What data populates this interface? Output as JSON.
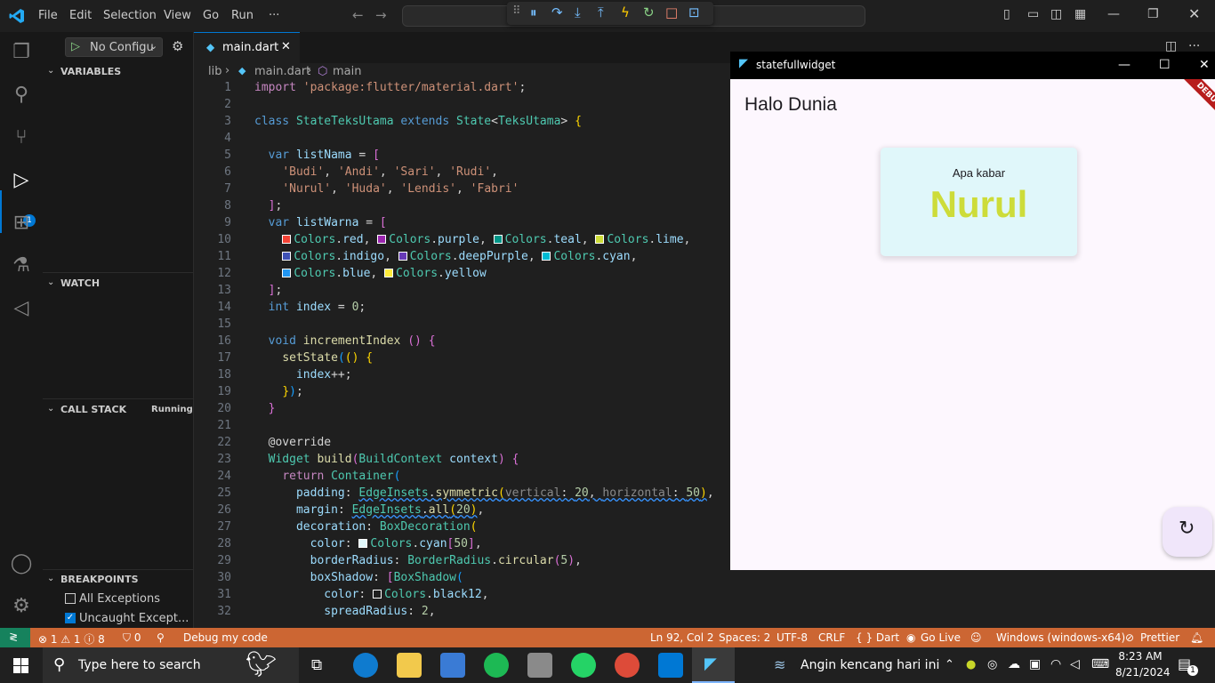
{
  "titlebar": {
    "menu": [
      "File",
      "Edit",
      "Selection",
      "View",
      "Go",
      "Run",
      "···"
    ]
  },
  "sidebar": {
    "run_config": "No Configu",
    "variables": "VARIABLES",
    "watch": "WATCH",
    "call_stack": "CALL STACK",
    "call_stack_status": "Running",
    "breakpoints": "BREAKPOINTS",
    "bp_all": "All Exceptions",
    "bp_uncaught": "Uncaught Except...",
    "debug_badge": "1"
  },
  "editor": {
    "tab": "main.dart",
    "breadcrumb": [
      "lib",
      "main.dart",
      "main"
    ],
    "line_numbers": [
      "1",
      "2",
      "3",
      "4",
      "5",
      "6",
      "7",
      "8",
      "9",
      "10",
      "11",
      "12",
      "13",
      "14",
      "15",
      "16",
      "17",
      "18",
      "19",
      "20",
      "21",
      "22",
      "23",
      "24",
      "25",
      "26",
      "27",
      "28",
      "29",
      "30",
      "31",
      "32"
    ]
  },
  "flutter_window": {
    "title": "statefullwidget",
    "heading": "Halo Dunia",
    "card_label": "Apa kabar",
    "card_name": "Nurul",
    "ribbon": "DEBUG",
    "name_color": "#cddc39",
    "card_color": "#e0f7fa"
  },
  "statusbar": {
    "errors": "⊗ 1 ⚠ 1 ⓘ 8",
    "ports": "⛉ 0",
    "debug": "Debug my code",
    "position": "Ln 92, Col 2",
    "spaces": "Spaces: 2",
    "encoding": "UTF-8",
    "eol": "CRLF",
    "language": "{ } Dart",
    "golive": "Go Live",
    "device": "Windows (windows-x64)",
    "prettier": "Prettier"
  },
  "taskbar": {
    "search_placeholder": "Type here to search",
    "weather": "Angin kencang hari ini",
    "time": "8:23 AM",
    "date": "8/21/2024",
    "notif_count": "1"
  },
  "colors": {
    "accent": "#0078d4",
    "statusbar": "#cc6633"
  }
}
